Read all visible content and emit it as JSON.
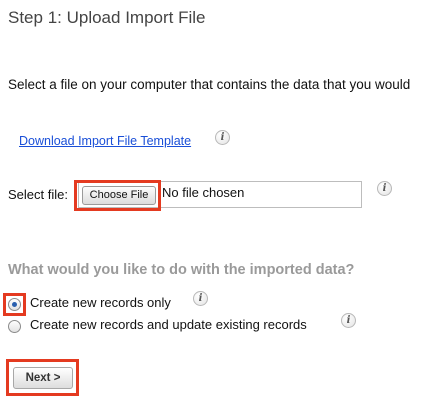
{
  "step": {
    "title": "Step 1: Upload Import File",
    "instructions": "Select a file on your computer that contains the data that you would"
  },
  "template_link": {
    "label": "Download Import File Template",
    "info_icon": "info-icon"
  },
  "file_select": {
    "label": "Select file:",
    "button_label": "Choose File",
    "status_text": "No file chosen",
    "info_icon": "info-icon"
  },
  "import_action": {
    "question": "What would you like to do with the imported data?",
    "options": [
      {
        "label": "Create new records only",
        "selected": true,
        "info_icon": "info-icon"
      },
      {
        "label": "Create new records and update existing records",
        "selected": false,
        "info_icon": "info-icon"
      }
    ]
  },
  "footer": {
    "next_label": "Next >"
  },
  "colors": {
    "highlight": "#e43a20",
    "link": "#1a4fd8",
    "question_text": "#9a9a9a"
  }
}
